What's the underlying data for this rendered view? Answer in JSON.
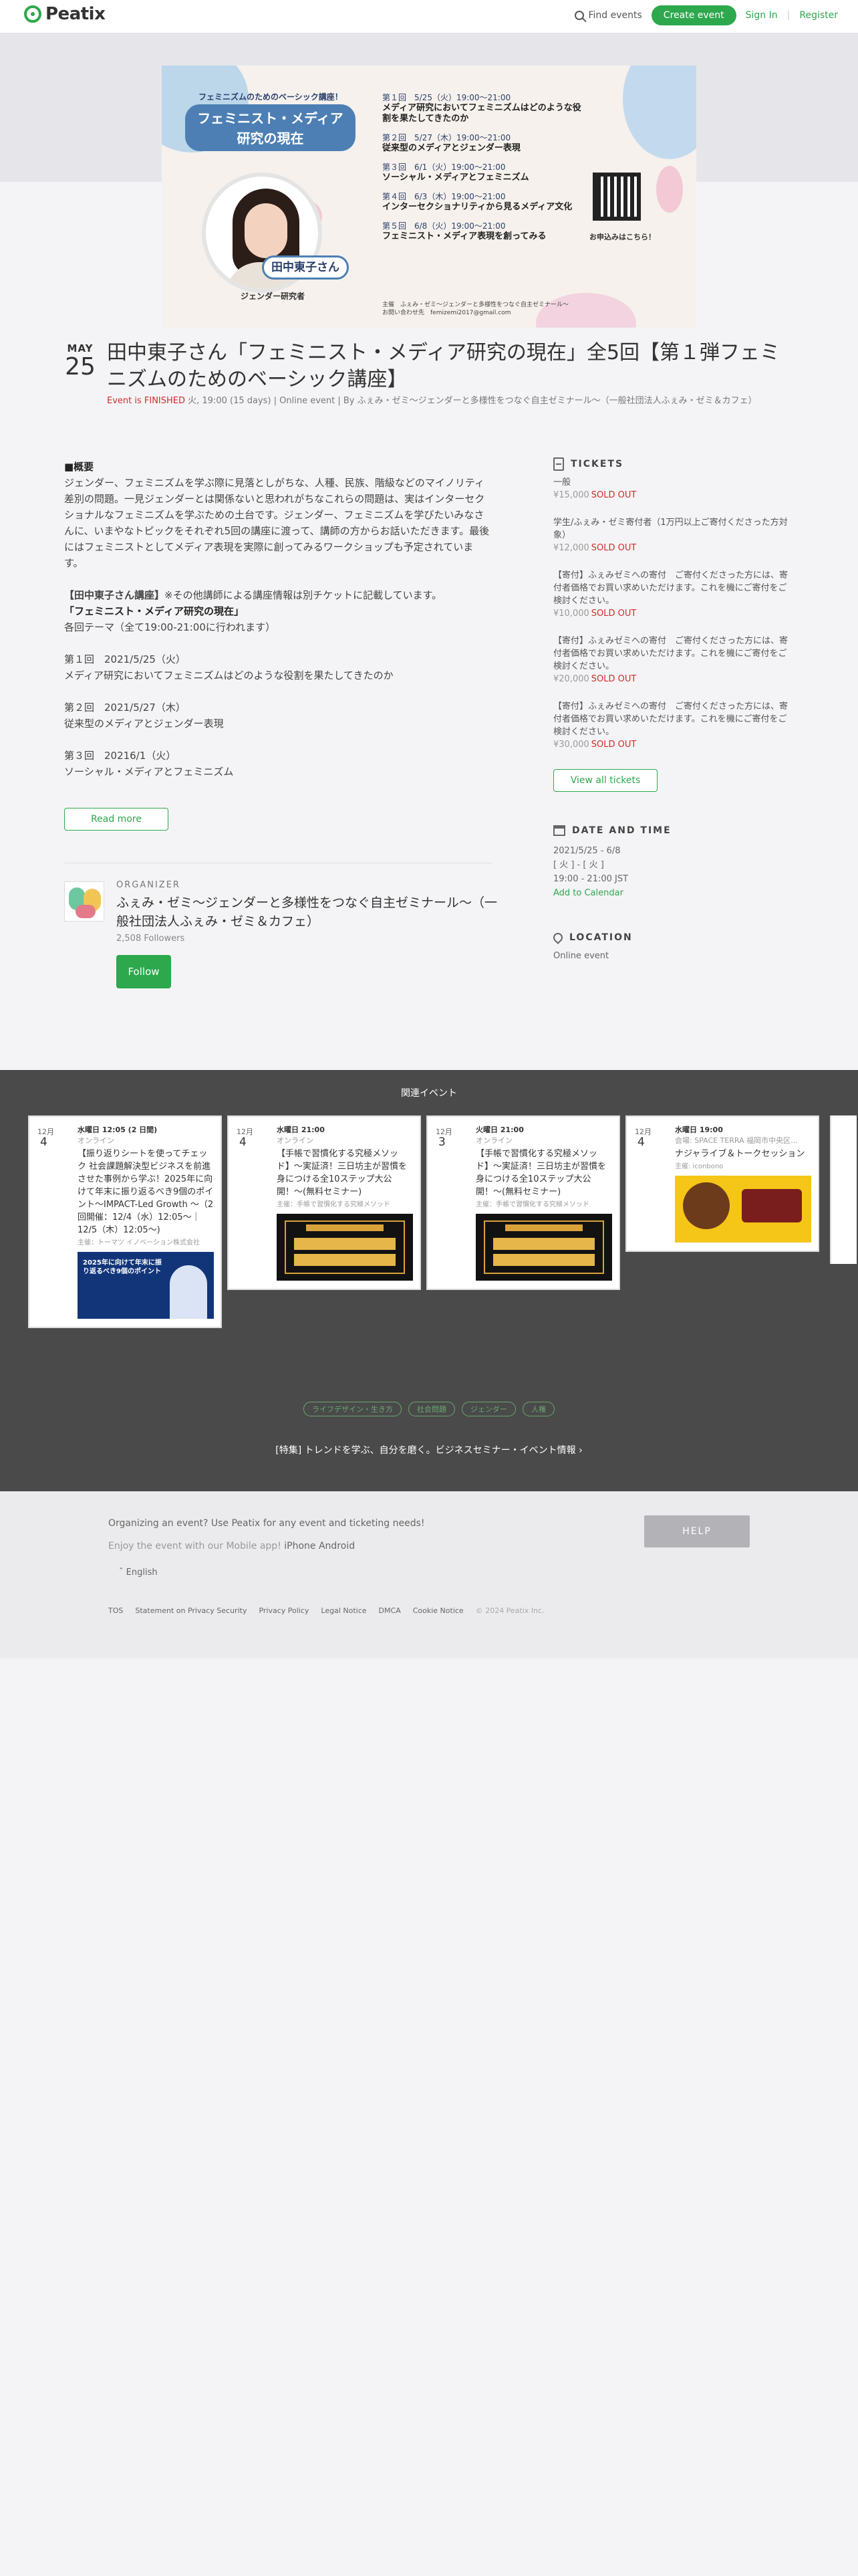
{
  "header": {
    "logo": "Peatix",
    "find_events": "Find events",
    "create_event": "Create event",
    "sign_in": "Sign In",
    "separator": "|",
    "register": "Register"
  },
  "banner": {
    "top_line": "フェミニズムのためのベーシック講座！",
    "title_line1": "フェミニスト・メディア",
    "title_line2": "研究の現在",
    "name_tag": "田中東子さん",
    "role": "ジェンダー研究者",
    "sessions": [
      {
        "when": "第１回　5/25（火）19:00〜21:00",
        "topic": "メディア研究においてフェミニズムはどのような役割を果たしてきたのか"
      },
      {
        "when": "第２回　5/27（木）19:00〜21:00",
        "topic": "従来型のメディアとジェンダー表現"
      },
      {
        "when": "第３回　6/1（火）19:00〜21:00",
        "topic": "ソーシャル・メディアとフェミニズム"
      },
      {
        "when": "第４回　6/3（木）19:00〜21:00",
        "topic": "インターセクショナリティから見るメディア文化"
      },
      {
        "when": "第５回　6/8（火）19:00〜21:00",
        "topic": "フェミニスト・メディア表現を創ってみる"
      }
    ],
    "qr_caption": "お申込みはこちら！",
    "footer_line1": "主催　ふぇみ・ゼミ〜ジェンダーと多様性をつなぐ自主ゼミナール〜",
    "footer_line2": "お問い合わせ先　femizemi2017@gmail.com"
  },
  "event": {
    "month": "MAY",
    "day": "25",
    "title": "田中東子さん「フェミニスト・メディア研究の現在」全5回【第１弾フェミニズムのためのベーシック講座】",
    "finished_label": "Event is FINISHED",
    "meta": " 火, 19:00 (15 days) | Online event | By ふぇみ・ゼミ〜ジェンダーと多様性をつなぐ自主ゼミナール〜（一般社団法人ふぇみ・ゼミ＆カフェ）"
  },
  "description": {
    "section_heading": "■概要",
    "intro": "ジェンダー、フェミニズムを学ぶ際に見落としがちな、人種、民族、階級などのマイノリティ差別の問題。一見ジェンダーとは関係ないと思われがちなこれらの問題は、実はインターセクショナルなフェミニズムを学ぶための土台です。ジェンダー、フェミニズムを学びたいみなさんに、いまやなトピックをそれぞれ5回の講座に渡って、講師の方からお話いただきます。最後にはフェミニストとしてメディア表現を実際に創ってみるワークショップも予定されています。",
    "course_bold": "【田中東子さん講座】",
    "course_note": "※その他講師による講座情報は別チケットに記載しています。",
    "course_title": "「フェミニスト・メディア研究の現在」",
    "schedule_note": "各回テーマ（全て19:00-21:00に行われます）",
    "s1_date": "第１回　2021/5/25（火）",
    "s1_topic": "メディア研究においてフェミニズムはどのような役割を果たしてきたのか",
    "s2_date": "第２回　2021/5/27（木）",
    "s2_topic": "従来型のメディアとジェンダー表現",
    "s3_date": "第３回　20216/1（火）",
    "s3_topic": "ソーシャル・メディアとフェミニズム",
    "read_more": "Read more"
  },
  "organizer": {
    "kicker": "ORGANIZER",
    "name": "ふぇみ・ゼミ〜ジェンダーと多様性をつなぐ自主ゼミナール〜（一般社団法人ふぇみ・ゼミ＆カフェ）",
    "followers": "2,508 Followers",
    "follow": "Follow"
  },
  "tickets": {
    "heading": "TICKETS",
    "sold_out": "SOLD OUT",
    "items": [
      {
        "name": "一般",
        "price": "¥15,000"
      },
      {
        "name": "学生/ふぇみ・ゼミ寄付者（1万円以上ご寄付くださった方対象）",
        "price": "¥12,000"
      },
      {
        "name": "【寄付】ふぇみゼミへの寄付　ご寄付くださった方には、寄付者価格でお買い求めいただけます。これを機にご寄付をご検討ください。",
        "price": "¥10,000"
      },
      {
        "name": "【寄付】ふぇみゼミへの寄付　ご寄付くださった方には、寄付者価格でお買い求めいただけます。これを機にご寄付をご検討ください。",
        "price": "¥20,000"
      },
      {
        "name": "【寄付】ふぇみゼミへの寄付　ご寄付くださった方には、寄付者価格でお買い求めいただけます。これを機にご寄付をご検討ください。",
        "price": "¥30,000"
      }
    ],
    "view_all": "View all tickets"
  },
  "datetime": {
    "heading": "DATE AND TIME",
    "range": "2021/5/25 - 6/8",
    "days": "[ 火 ] - [ 火 ]",
    "time": "19:00 - 21:00 JST",
    "add_calendar": "Add to Calendar"
  },
  "location": {
    "heading": "LOCATION",
    "value": "Online event"
  },
  "related": {
    "heading": "関連イベント",
    "cards": [
      {
        "month": "12月",
        "day": "4",
        "time": "水曜日 12:05 (2 日間)",
        "venue": "オンライン",
        "title": "【振り返りシートを使ってチェック 社会課題解決型ビジネスを前進させた事例から学ぶ！2025年に向けて年末に振り返るべき9個のポイント〜IMPACT-Led Growth 〜（2回開催：12/4（水）12:05〜｜12/5（木）12:05〜)",
        "org": "主催：トーマツ イノベーション株式会社",
        "img_text": "2025年に向けて年末に振り返るべき9個のポイント"
      },
      {
        "month": "12月",
        "day": "4",
        "time": "水曜日 21:00",
        "venue": "オンライン",
        "title": "【手帳で習慣化する究極メソッド】〜実証済！三日坊主が習慣を身につける全10ステップ大公開！〜(無料セミナー)",
        "org": "主催：手帳で習慣化する究極メソッド",
        "img_text": "【無料セミナー】手帳で習慣化する究極メソッド"
      },
      {
        "month": "12月",
        "day": "3",
        "time": "火曜日 21:00",
        "venue": "オンライン",
        "title": "【手帳で習慣化する究極メソッド】〜実証済！三日坊主が習慣を身につける全10ステップ大公開！〜(無料セミナー)",
        "org": "主催：手帳で習慣化する究極メソッド",
        "img_text": "【無料セミナー】手帳で習慣化する究極メソッド"
      },
      {
        "month": "12月",
        "day": "4",
        "time": "水曜日 19:00",
        "venue": "会場: SPACE TERRA 福岡市中央区…",
        "title": "ナジャライブ＆トークセッション",
        "org": "主催: iconbono",
        "img_text": "Nadja Live & トークセッション"
      }
    ],
    "tags": [
      "ライフデザイン・生き方",
      "社会問題",
      "ジェンダー",
      "人権"
    ],
    "feature": "[特集] トレンドを学ぶ、自分を磨く。ビジネスセミナー・イベント情報"
  },
  "footer": {
    "organizing": "Organizing an event? Use Peatix for any event and ticketing needs!",
    "mobile_prefix": "Enjoy the event with our Mobile app!",
    "iphone": "iPhone",
    "android": "Android",
    "help": "HELP",
    "language": "English",
    "links": [
      "TOS",
      "Statement on Privacy Security",
      "Privacy Policy",
      "Legal Notice",
      "DMCA",
      "Cookie Notice"
    ],
    "copyright": "© 2024 Peatix Inc."
  }
}
